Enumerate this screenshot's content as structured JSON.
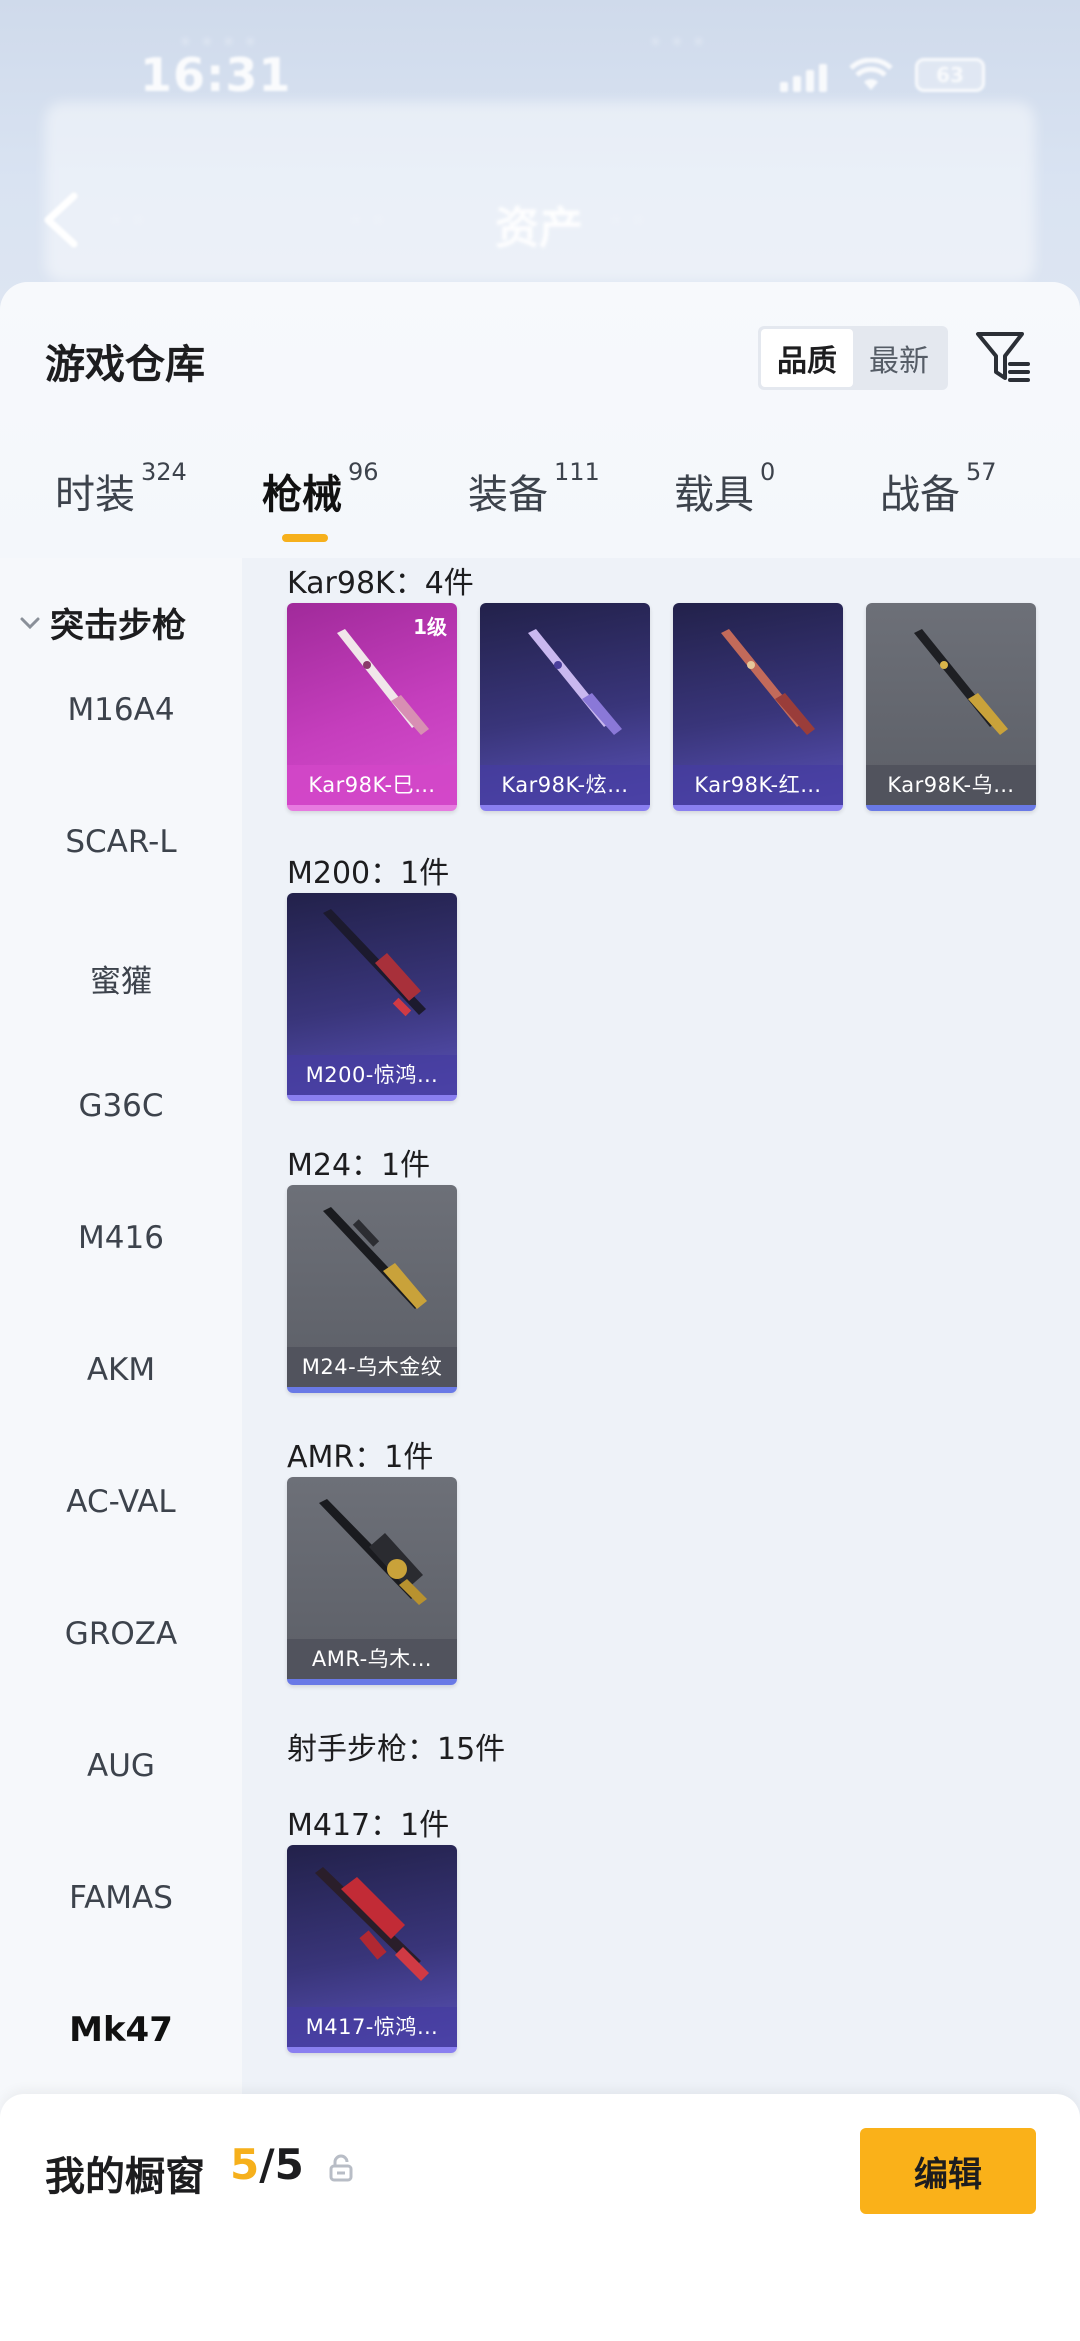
{
  "status_bar": {
    "time": "16:31",
    "battery": "63"
  },
  "previous_page": {
    "title": "资产"
  },
  "sheet": {
    "title": "游戏仓库",
    "sort_options": [
      {
        "label": "品质",
        "active": true
      },
      {
        "label": "最新",
        "active": false
      }
    ],
    "tabs": [
      {
        "label": "时装",
        "count": "324",
        "active": false
      },
      {
        "label": "枪械",
        "count": "96",
        "active": true
      },
      {
        "label": "装备",
        "count": "111",
        "active": false
      },
      {
        "label": "载具",
        "count": "0",
        "active": false
      },
      {
        "label": "战备",
        "count": "57",
        "active": false
      }
    ]
  },
  "categories": {
    "group_label": "突击步枪",
    "items": [
      "M16A4",
      "SCAR-L",
      "蜜獾",
      "G36C",
      "M416",
      "AKM",
      "AC-VAL",
      "GROZA",
      "AUG",
      "FAMAS",
      "Mk47"
    ]
  },
  "sections": [
    {
      "title": "Kar98K：4件",
      "cards": [
        {
          "name": "Kar98K-巳…",
          "style": "pink",
          "level": "1级"
        },
        {
          "name": "Kar98K-炫…",
          "style": "purple",
          "level": ""
        },
        {
          "name": "Kar98K-红…",
          "style": "purple",
          "level": ""
        },
        {
          "name": "Kar98K-乌…",
          "style": "gray",
          "level": ""
        }
      ]
    },
    {
      "title": "M200：1件",
      "cards": [
        {
          "name": "M200-惊鸿…",
          "style": "purple",
          "level": ""
        }
      ]
    },
    {
      "title": "M24：1件",
      "cards": [
        {
          "name": "M24-乌木金纹",
          "style": "gray",
          "level": ""
        }
      ]
    },
    {
      "title": "AMR：1件",
      "cards": [
        {
          "name": "AMR-乌木…",
          "style": "gray",
          "level": ""
        }
      ]
    }
  ],
  "group_marksman": {
    "title": "射手步枪：15件"
  },
  "section_m417": {
    "title": "M417：1件",
    "cards": [
      {
        "name": "M417-惊鸿…",
        "style": "purple",
        "level": ""
      }
    ]
  },
  "bottom_bar": {
    "label": "我的橱窗",
    "current": "5",
    "total": "/5",
    "edit_label": "编辑"
  },
  "colors": {
    "accent": "#fab119",
    "tab_indicator": "#f6b01c",
    "pink_card": "#c53ebd",
    "purple_card": "#39357a",
    "gray_card": "#5c5f67"
  }
}
